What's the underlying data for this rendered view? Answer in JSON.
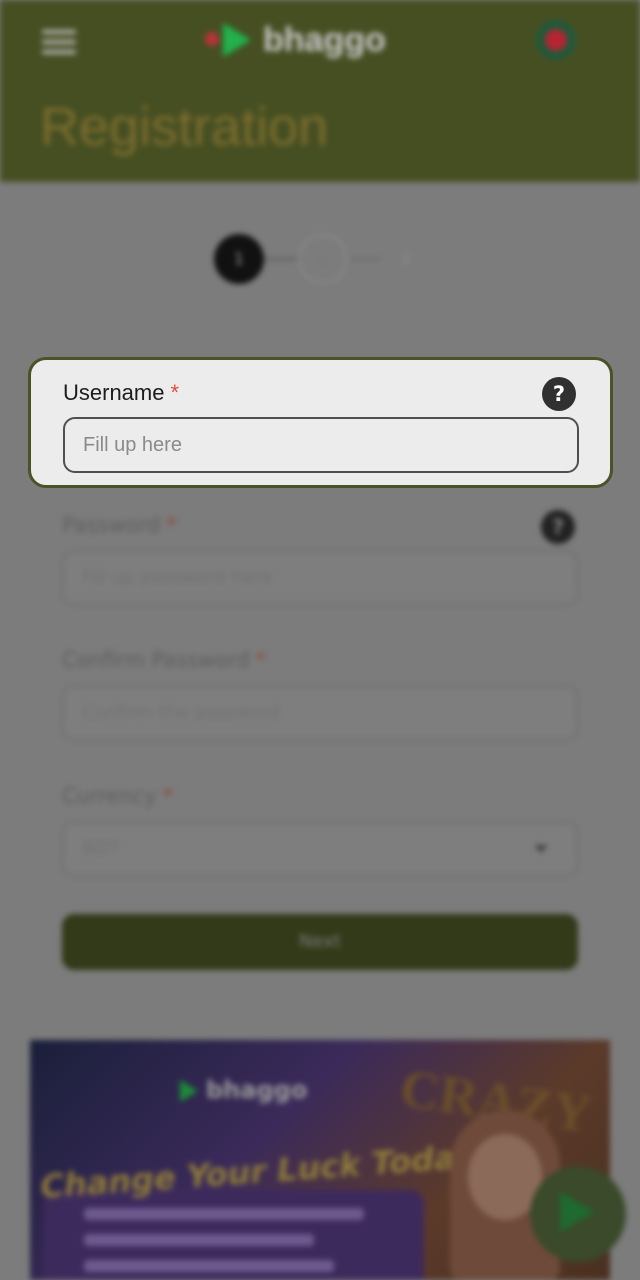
{
  "header": {
    "brand": "bhaggo",
    "page_title": "Registration",
    "menu_icon": "hamburger-icon",
    "language_icon": "bangladesh-flag-icon"
  },
  "steps": [
    "1",
    "2",
    "3"
  ],
  "form": {
    "username": {
      "label": "Username",
      "required_mark": "*",
      "placeholder": "Fill up here",
      "help_glyph": "?"
    },
    "password": {
      "label": "Password",
      "required_mark": "*",
      "placeholder": "Fill up password here",
      "help_glyph": "?"
    },
    "confirm_password": {
      "label": "Confirm Password",
      "required_mark": "*",
      "placeholder": "Confirm the password"
    },
    "currency": {
      "label": "Currency",
      "required_mark": "*",
      "selected": "BDT"
    },
    "next_label": "Next"
  },
  "banner": {
    "brand": "bhaggo",
    "headline": "Change Your Luck Today!",
    "game_text": "CRAZY"
  },
  "colors": {
    "header_bg": "#464f22",
    "focus_border": "#4b5326",
    "required": "#e74c3c",
    "next_button": "#323a19"
  }
}
